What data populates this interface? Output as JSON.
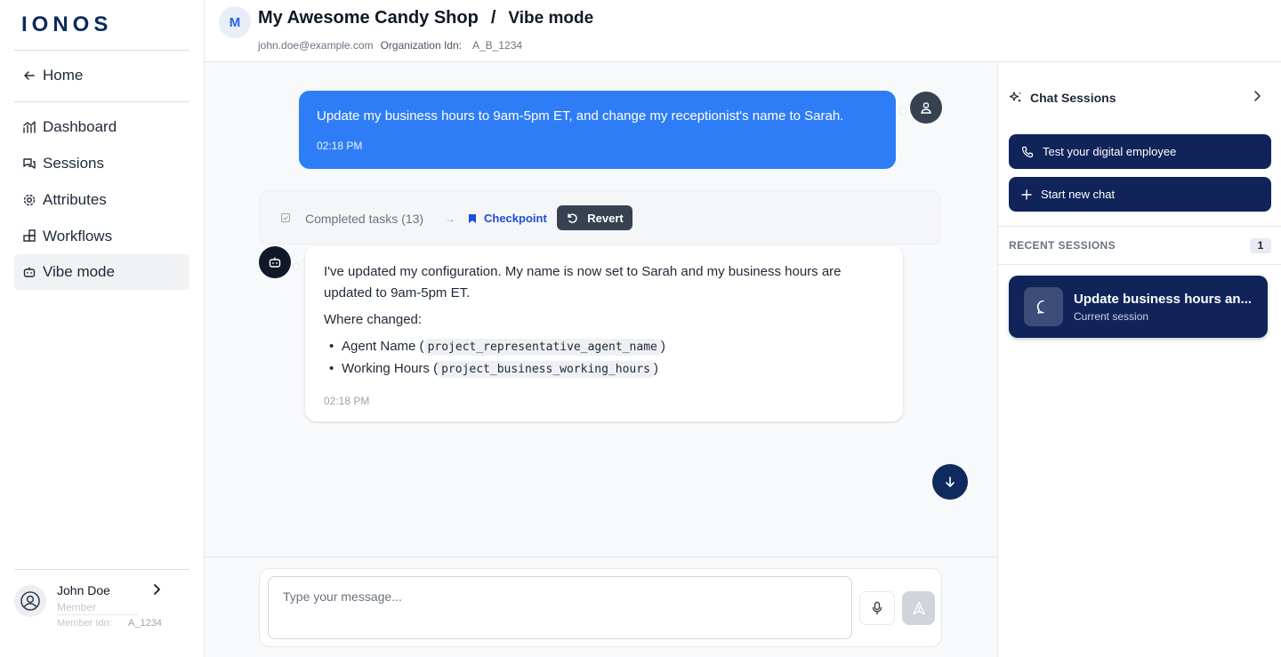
{
  "sidebar": {
    "logo": "IONOS",
    "home_label": "Home",
    "items": [
      {
        "label": "Dashboard",
        "icon": "chart-icon"
      },
      {
        "label": "Sessions",
        "icon": "chat-icon"
      },
      {
        "label": "Attributes",
        "icon": "gear-icon"
      },
      {
        "label": "Workflows",
        "icon": "blocks-icon"
      },
      {
        "label": "Vibe mode",
        "icon": "bot-icon",
        "active": true
      }
    ],
    "user": {
      "name": "John Doe",
      "role": "Member",
      "idn_label": "Member Idn:",
      "idn_value": "A_1234"
    }
  },
  "header": {
    "avatar_letter": "M",
    "org_name": "My Awesome Candy Shop",
    "separator": "/",
    "page": "Vibe mode",
    "email": "john.doe@example.com",
    "org_idn_label": "Organization Idn:",
    "org_idn_value": "A_B_1234"
  },
  "chat": {
    "user_message": {
      "text": "Update my business hours to 9am-5pm ET, and change my receptionist's name to Sarah.",
      "time": "02:18 PM"
    },
    "tasks": {
      "completed_label": "Completed tasks (13)",
      "arrow": "→",
      "checkpoint_label": "Checkpoint",
      "revert_label": "Revert"
    },
    "bot_message": {
      "text": "I've updated my configuration. My name is now set to Sarah and my business hours are updated to 9am-5pm ET.",
      "where_label": "Where changed:",
      "changes": [
        {
          "name": "Agent Name",
          "code": "project_representative_agent_name"
        },
        {
          "name": "Working Hours",
          "code": "project_business_working_hours"
        }
      ],
      "time": "02:18 PM"
    }
  },
  "composer": {
    "placeholder": "Type your message..."
  },
  "right_panel": {
    "title": "Chat Sessions",
    "test_button": "Test your digital employee",
    "new_chat_button": "Start new chat",
    "recent_label": "RECENT SESSIONS",
    "recent_count": "1",
    "session": {
      "title": "Update business hours an...",
      "subtitle": "Current session"
    }
  },
  "colors": {
    "user_bubble": "#2f7df6",
    "navy": "#10245a",
    "checkpoint": "#1d4ed8"
  }
}
